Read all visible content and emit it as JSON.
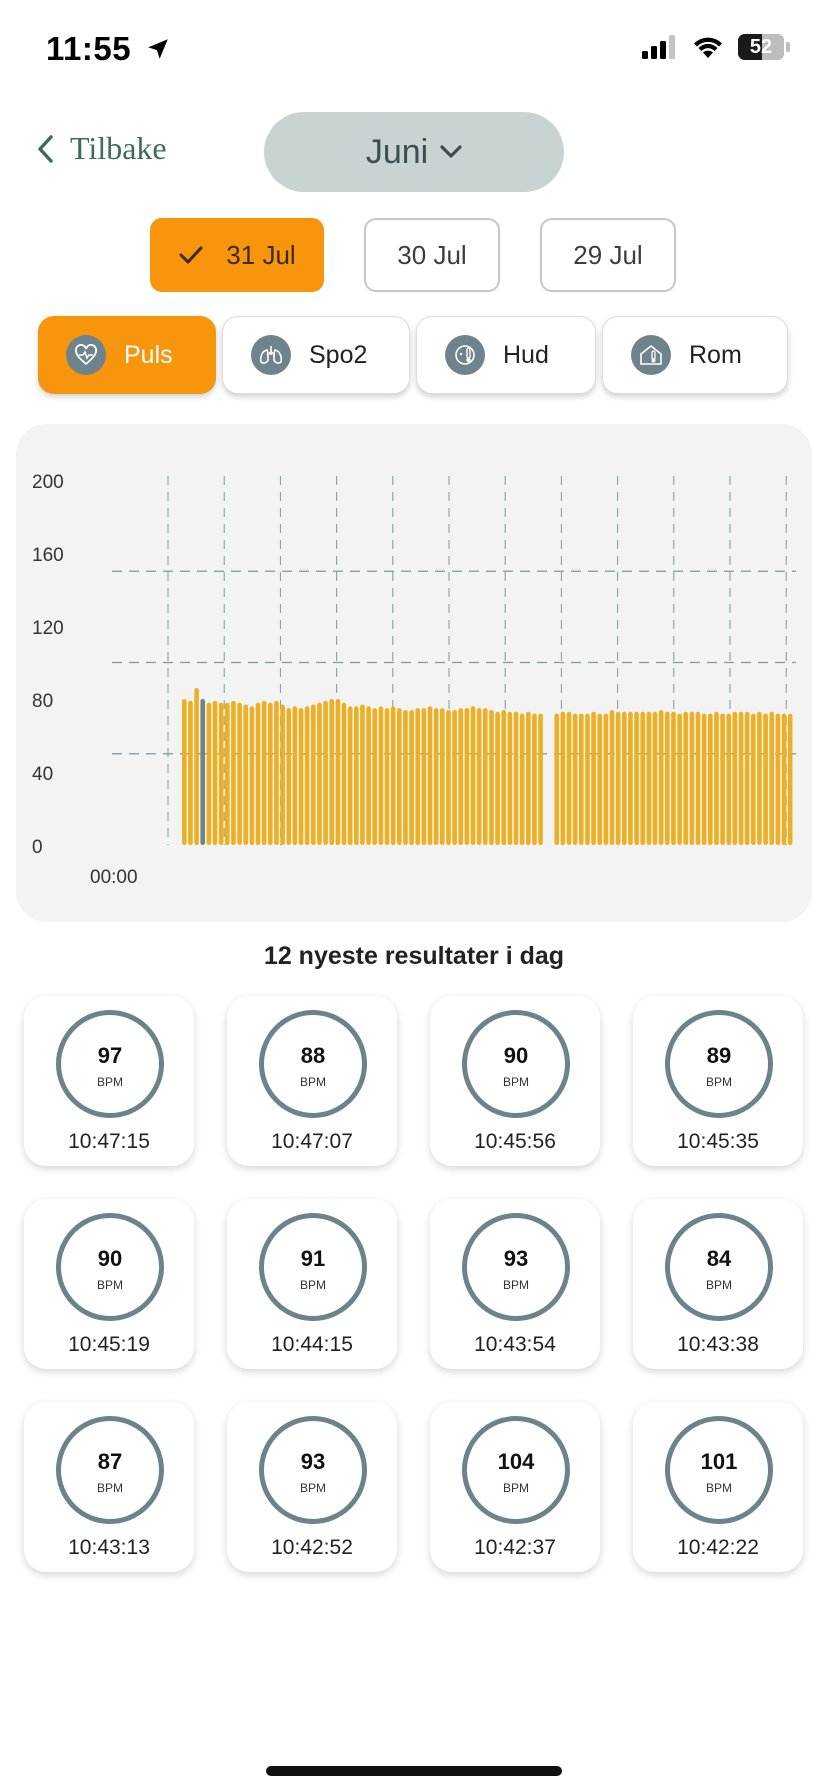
{
  "status_bar": {
    "time": "11:55",
    "battery": "52",
    "battery_level": 0.52
  },
  "header": {
    "back_label": "Tilbake",
    "month": "Juni"
  },
  "dates": [
    {
      "label": "31 Jul",
      "active": true
    },
    {
      "label": "30 Jul",
      "active": false
    },
    {
      "label": "29 Jul",
      "active": false
    }
  ],
  "metrics": [
    {
      "label": "Puls",
      "icon": "heart-pulse-icon",
      "active": true
    },
    {
      "label": "Spo2",
      "icon": "lungs-icon",
      "active": false
    },
    {
      "label": "Hud",
      "icon": "skin-thermometer-icon",
      "active": false
    },
    {
      "label": "Rom",
      "icon": "room-thermometer-icon",
      "active": false
    }
  ],
  "colors": {
    "accent": "#f7960d",
    "bar": "#ecb022",
    "highlight_bar": "#6f838c",
    "ring": "#6e8289",
    "back": "#3e6b5a"
  },
  "chart_data": {
    "type": "bar",
    "ylim": [
      0,
      200
    ],
    "yticks": [
      0,
      40,
      80,
      120,
      160,
      200
    ],
    "xlabel": "",
    "ylabel": "",
    "x_start_label": "00:00",
    "reference_lines": [
      50,
      100,
      150
    ],
    "highlight_index": 3,
    "gap_after_index": 58,
    "values": [
      80,
      79,
      86,
      80,
      78,
      79,
      78,
      78,
      79,
      78,
      77,
      76,
      78,
      79,
      78,
      79,
      77,
      75,
      76,
      75,
      76,
      77,
      78,
      79,
      80,
      80,
      78,
      76,
      76,
      77,
      76,
      75,
      76,
      75,
      76,
      75,
      74,
      74,
      75,
      75,
      76,
      75,
      75,
      74,
      74,
      75,
      75,
      76,
      75,
      75,
      74,
      73,
      74,
      73,
      73,
      72,
      73,
      72,
      72,
      72,
      73,
      73,
      72,
      72,
      72,
      73,
      72,
      72,
      74,
      73,
      73,
      73,
      73,
      73,
      73,
      73,
      74,
      73,
      73,
      72,
      73,
      73,
      73,
      72,
      72,
      73,
      72,
      72,
      73,
      73,
      73,
      72,
      73,
      72,
      73,
      72,
      72,
      72
    ]
  },
  "results_title": "12 nyeste resultater i dag",
  "results": [
    {
      "value": "97",
      "unit": "BPM",
      "time": "10:47:15"
    },
    {
      "value": "88",
      "unit": "BPM",
      "time": "10:47:07"
    },
    {
      "value": "90",
      "unit": "BPM",
      "time": "10:45:56"
    },
    {
      "value": "89",
      "unit": "BPM",
      "time": "10:45:35"
    },
    {
      "value": "90",
      "unit": "BPM",
      "time": "10:45:19"
    },
    {
      "value": "91",
      "unit": "BPM",
      "time": "10:44:15"
    },
    {
      "value": "93",
      "unit": "BPM",
      "time": "10:43:54"
    },
    {
      "value": "84",
      "unit": "BPM",
      "time": "10:43:38"
    },
    {
      "value": "87",
      "unit": "BPM",
      "time": "10:43:13"
    },
    {
      "value": "93",
      "unit": "BPM",
      "time": "10:42:52"
    },
    {
      "value": "104",
      "unit": "BPM",
      "time": "10:42:37"
    },
    {
      "value": "101",
      "unit": "BPM",
      "time": "10:42:22"
    }
  ]
}
